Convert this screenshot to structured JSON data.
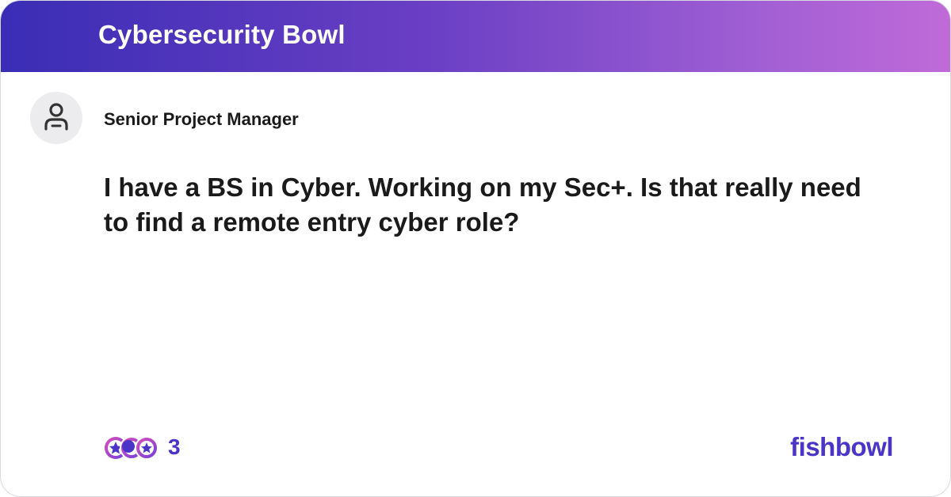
{
  "header": {
    "title": "Cybersecurity Bowl"
  },
  "post": {
    "author": "Senior Project Manager",
    "text": "I have a BS in Cyber. Working on my Sec+. Is that really need to find a remote entry cyber role?"
  },
  "reactions": {
    "count": "3"
  },
  "brand": {
    "name": "fishbowl"
  },
  "colors": {
    "header_gradient_start": "#3a2db5",
    "header_gradient_end": "#c06ad8",
    "accent": "#4a35c8",
    "text": "#1a1a1a"
  },
  "icons": {
    "avatar": "user-icon",
    "reactions": [
      "star-reaction-icon",
      "crescent-reaction-icon",
      "star-reaction-icon"
    ]
  }
}
